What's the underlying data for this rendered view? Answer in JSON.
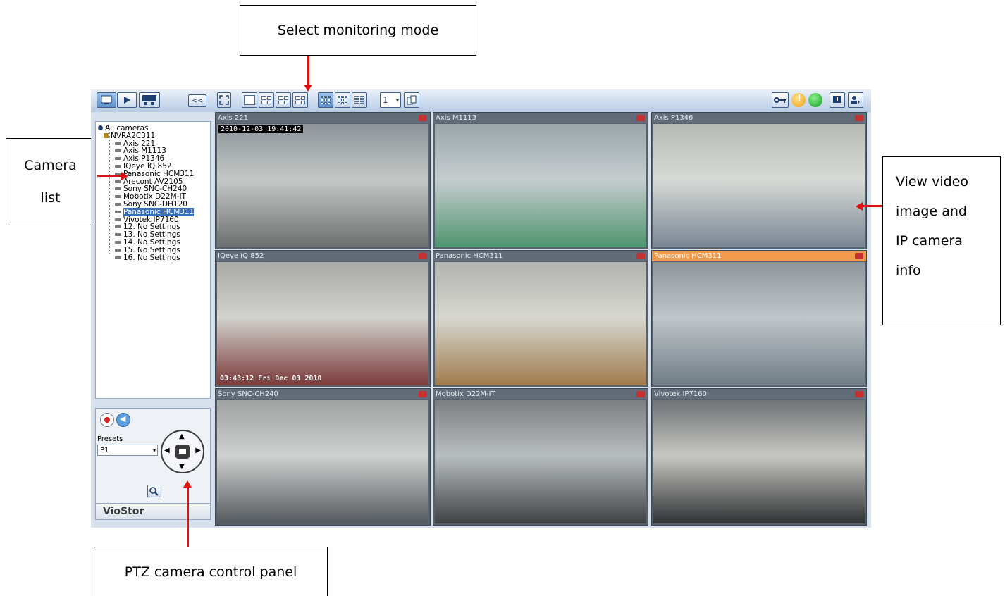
{
  "callouts": {
    "mode": "Select monitoring mode",
    "camlist_line1": "Camera",
    "camlist_line2": "list",
    "view_line1": "View video",
    "view_line2": "image and",
    "view_line3": "IP camera",
    "view_line4": "info",
    "ptz": "PTZ camera control panel"
  },
  "toolbar": {
    "collapse": "<<",
    "page": "1"
  },
  "tree": {
    "root": "All cameras",
    "server": "NVRA2C311",
    "cameras": [
      "Axis 221",
      "Axis M1113",
      "Axis P1346",
      "IQeye IQ 852",
      "Panasonic HCM311",
      "Arecont AV2105",
      "Sony SNC-CH240",
      "Mobotix D22M-IT",
      "Sony SNC-DH120",
      "Panasonic HCM311",
      "Vivotek IP7160",
      "12. No Settings",
      "13. No Settings",
      "14. No Settings",
      "15. No Settings",
      "16. No Settings"
    ],
    "selected_index": 9
  },
  "ptz": {
    "presets_label": "Presets",
    "preset_value": "P1"
  },
  "brand": "VioStor",
  "tiles": [
    {
      "name": "Axis 221",
      "stamp": "2010-12-03 19:41:42"
    },
    {
      "name": "Axis M1113"
    },
    {
      "name": "Axis P1346"
    },
    {
      "name": "IQeye IQ 852",
      "stamp_bottom": "03:43:12 Fri Dec 03 2010"
    },
    {
      "name": "Panasonic HCM311"
    },
    {
      "name": "Panasonic HCM311",
      "highlight": true
    },
    {
      "name": "Sony SNC-CH240"
    },
    {
      "name": "Mobotix D22M-IT"
    },
    {
      "name": "Vivotek IP7160"
    }
  ],
  "colors": {
    "arrow": "#e01010",
    "highlight_header": "#f29a4b",
    "tree_selection": "#3a6eb8"
  }
}
